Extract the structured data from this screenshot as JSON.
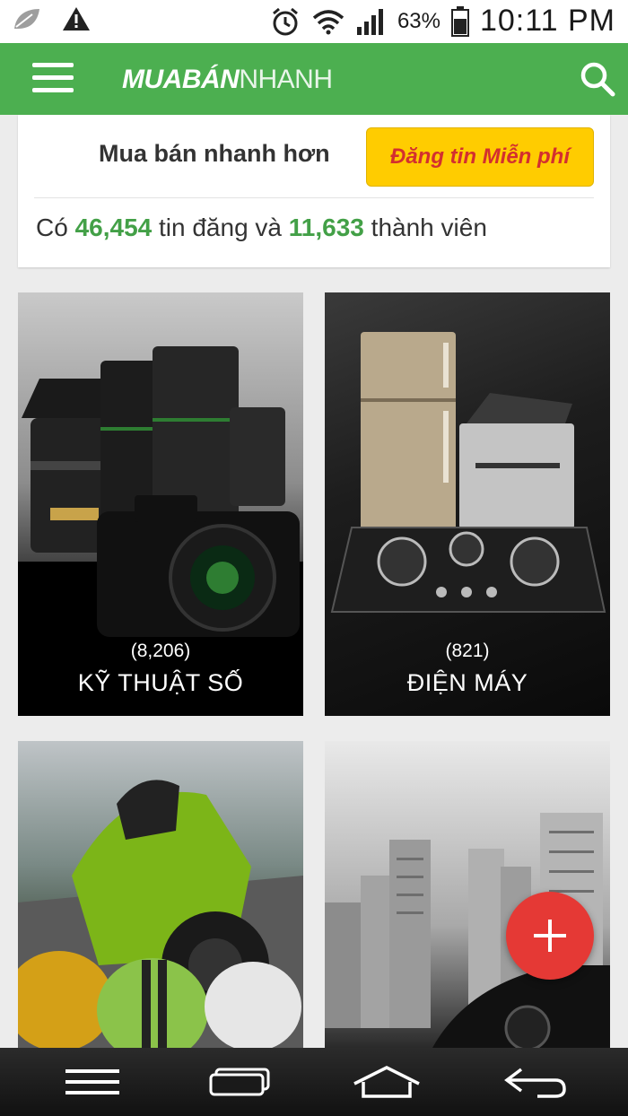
{
  "status_bar": {
    "battery_percent": "63%",
    "time": "10:11 PM",
    "icons": [
      "leaf-icon",
      "warning-icon",
      "alarm-icon",
      "wifi-icon",
      "signal-icon",
      "battery-icon"
    ]
  },
  "header": {
    "logo_part1": "MUABÁN",
    "logo_part2": "NHANH",
    "menu_icon": "hamburger-icon",
    "search_icon": "search-icon",
    "color": "#4caf50"
  },
  "promo": {
    "tagline": "Mua bán nhanh hơn",
    "cta_label": "Đăng tin Miễn phí",
    "stats_prefix": "Có",
    "listings_count": "46,454",
    "stats_middle": "tin đăng và",
    "members_count": "11,633",
    "stats_suffix": "thành viên"
  },
  "categories": [
    {
      "count": "(8,206)",
      "name": "KỸ THUẬT SỐ"
    },
    {
      "count": "(821)",
      "name": "ĐIỆN MÁY"
    },
    {
      "count": "",
      "name": ""
    },
    {
      "count": "",
      "name": ""
    }
  ],
  "fab": {
    "icon": "plus-icon",
    "color": "#e53935"
  },
  "nav_bar": {
    "icons": [
      "menu-icon",
      "recent-apps-icon",
      "home-icon",
      "back-icon"
    ]
  }
}
